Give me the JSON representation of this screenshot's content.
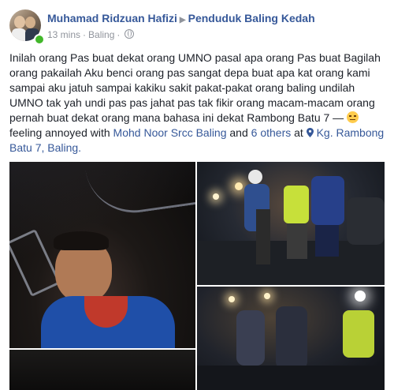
{
  "post": {
    "author": "Muhamad Ridzuan Hafizi",
    "group": "Penduduk Baling Kedah",
    "time": "13 mins",
    "location_meta": "Baling",
    "separator": "·",
    "text": "Inilah orang Pas buat dekat orang UMNO pasal apa orang Pas buat Bagilah orang pakailah Aku benci orang pas sangat depa buat apa kat orang kami sampai aku jatuh sampai kakiku sakit pakat-pakat orang baling undilah UMNO tak yah undi pas pas jahat pas tak fikir orang macam-macam orang pernah buat dekat orang mana bahasa ini dekat Rambong Batu 7 —",
    "feeling_text": "feeling annoyed with",
    "tagged_person": "Mohd Noor Srcc Baling",
    "and_text": "and",
    "others": "6 others",
    "at_text": "at",
    "place": "Kg. Rambong Batu 7, Baling."
  },
  "icons": {
    "arrow": "▶",
    "feeling": "annoyed-face-icon",
    "location": "location-pin-icon",
    "privacy": "globe-icon"
  },
  "colors": {
    "link": "#365899",
    "meta": "#90949c",
    "text": "#1d2129",
    "online": "#42b72a"
  }
}
